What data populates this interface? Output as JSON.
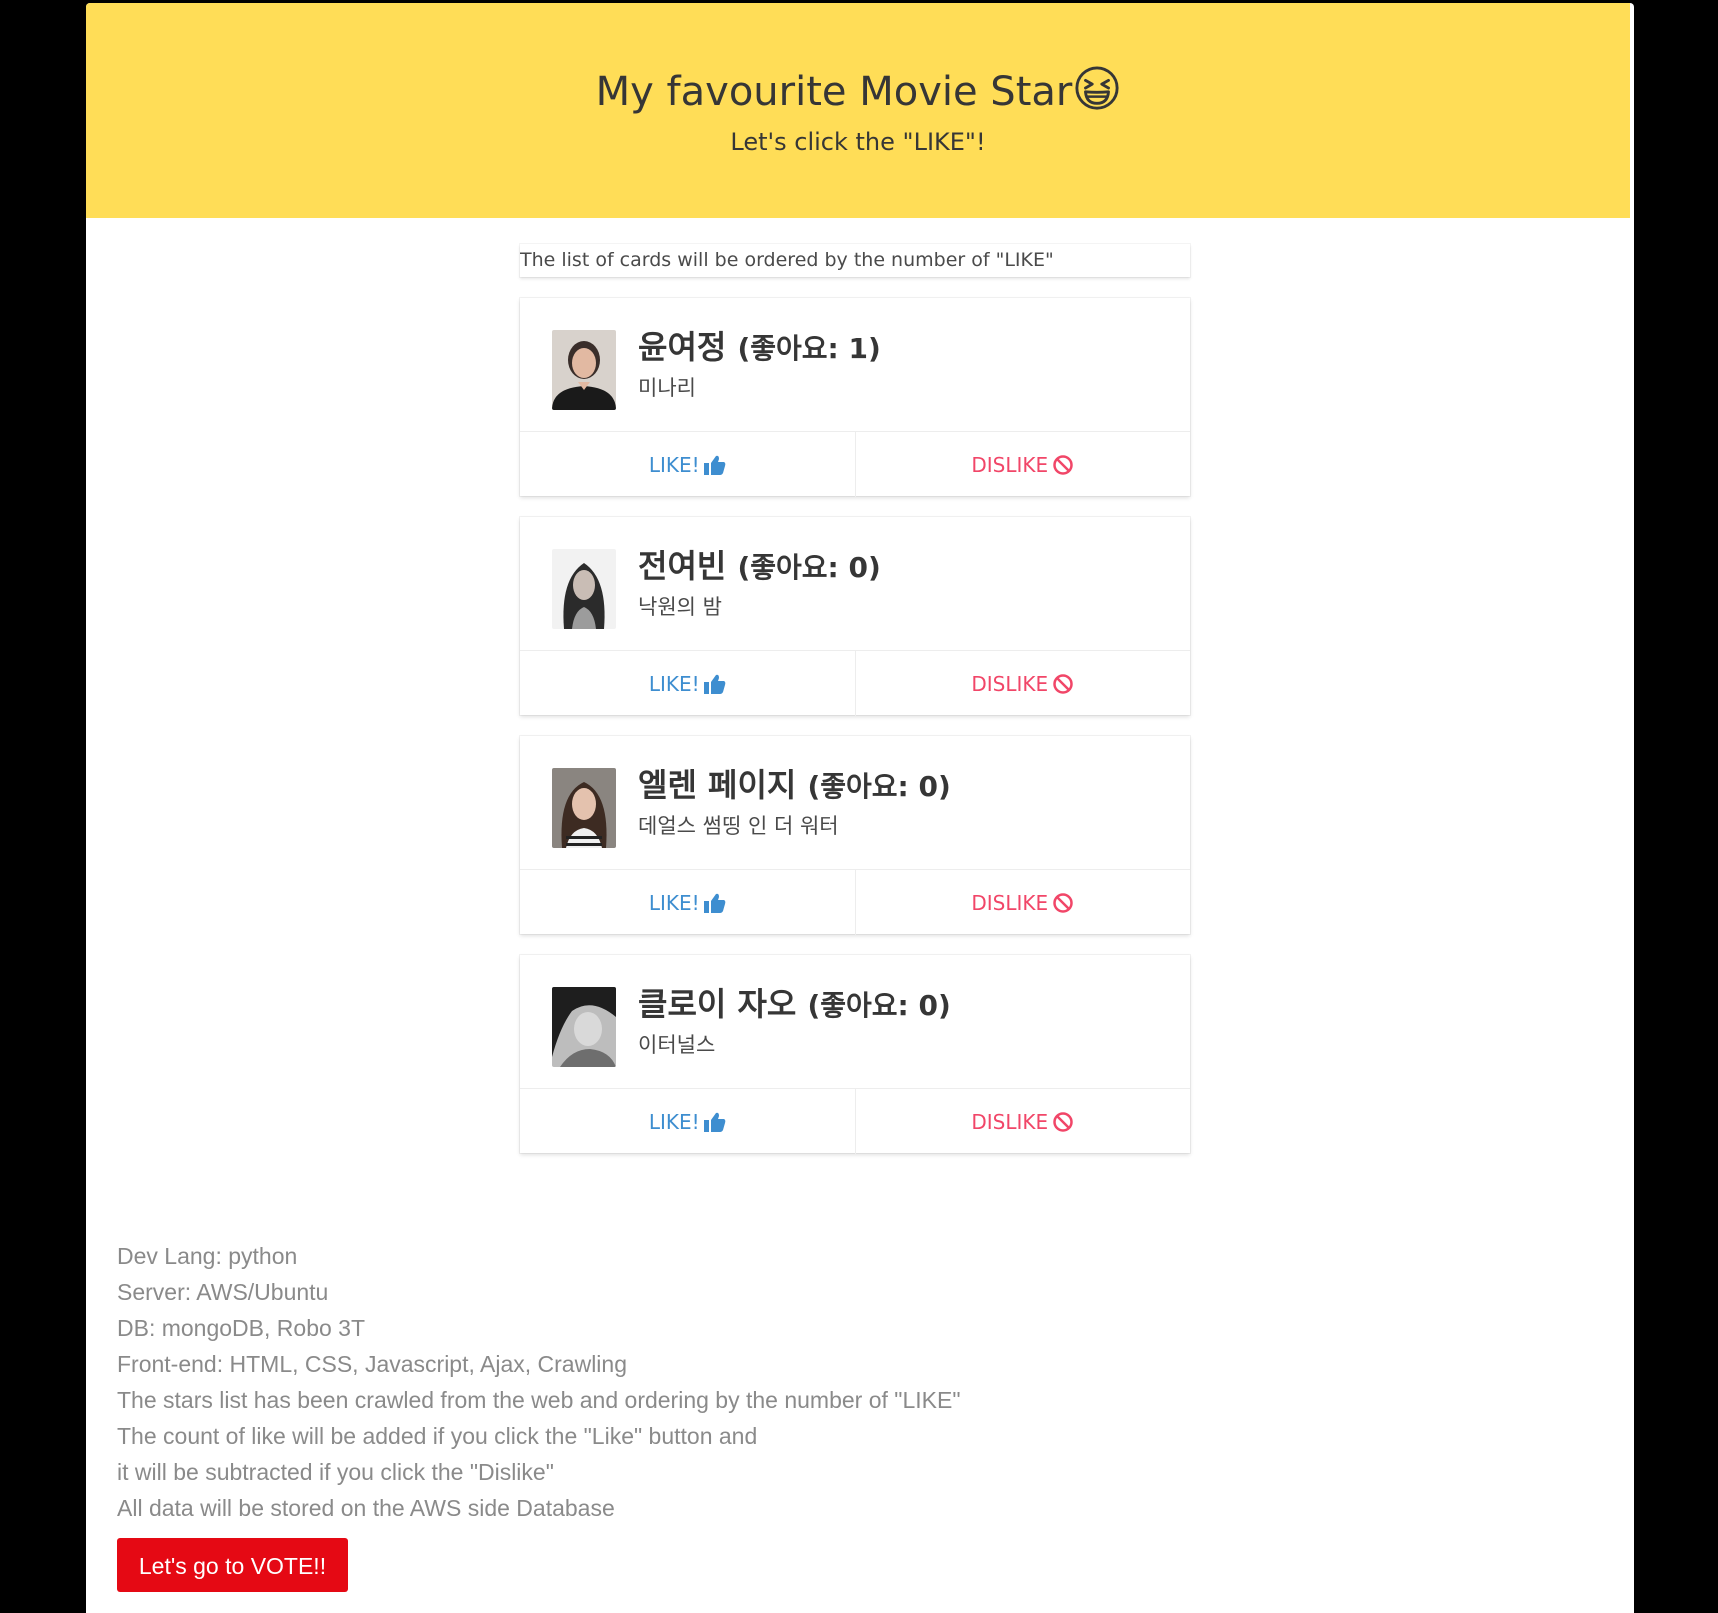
{
  "hero": {
    "title": "My favourite Movie Star",
    "emoji_icon": "laughing-face-icon",
    "subtitle": "Let's click the \"LIKE\"!"
  },
  "notice": "The list of cards will be ordered by the number of \"LIKE\"",
  "cards": [
    {
      "name": "윤여정",
      "likes_text": "(좋아요: 1)",
      "likes": 1,
      "movie": "미나리",
      "like_label": "LIKE!",
      "dislike_label": "DISLIKE"
    },
    {
      "name": "전여빈",
      "likes_text": "(좋아요: 0)",
      "likes": 0,
      "movie": "낙원의 밤",
      "like_label": "LIKE!",
      "dislike_label": "DISLIKE"
    },
    {
      "name": "엘렌 페이지",
      "likes_text": "(좋아요: 0)",
      "likes": 0,
      "movie": "데얼스 썸띵 인 더 워터",
      "like_label": "LIKE!",
      "dislike_label": "DISLIKE"
    },
    {
      "name": "클로이 자오",
      "likes_text": "(좋아요: 0)",
      "likes": 0,
      "movie": "이터널스",
      "like_label": "LIKE!",
      "dislike_label": "DISLIKE"
    }
  ],
  "icons": {
    "like": "thumbs-up-icon",
    "dislike": "ban-icon"
  },
  "footer_lines": [
    "Dev Lang: python",
    "Server: AWS/Ubuntu",
    "DB: mongoDB, Robo 3T",
    "Front-end: HTML, CSS, Javascript, Ajax, Crawling",
    "The stars list has been crawled from the web and ordering by the number of \"LIKE\"",
    "The count of like will be added if you click the \"Like\" button and",
    "it will be subtracted if you click the \"Dislike\"",
    "All data will be stored on the AWS side Database"
  ],
  "vote_button": "Let's go to VOTE!!",
  "colors": {
    "hero_bg": "#ffdd57",
    "like": "#3e8ed0",
    "dislike": "#f14668",
    "vote_bg": "#e50914"
  }
}
